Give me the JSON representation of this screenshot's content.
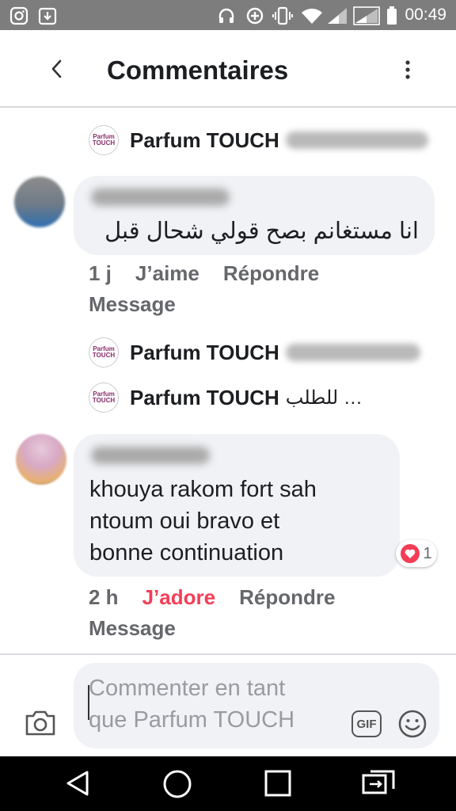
{
  "statusbar": {
    "time": "00:49"
  },
  "header": {
    "title": "Commentaires"
  },
  "reply_previews": [
    {
      "name": "Parfum TOUCH",
      "snippet": ""
    },
    {
      "name": "Parfum TOUCH",
      "snippet": ""
    },
    {
      "name": "Parfum TOUCH",
      "snippet": "… للطلب"
    }
  ],
  "page_avatar_text": "Parfum TOUCH",
  "comments": [
    {
      "text": "انا مستغانم  بصح قولي شحال قبل",
      "time": "1 j",
      "like_label": "J’aime",
      "reply_label": "Répondre",
      "message_label": "Message"
    },
    {
      "text_lines": [
        "khouya rakom fort sah",
        "ntoum oui bravo et",
        "bonne continuation"
      ],
      "time": "2 h",
      "like_label": "J’adore",
      "reply_label": "Répondre",
      "message_label": "Message",
      "reaction_count": "1"
    }
  ],
  "composer": {
    "placeholder_line1": "Commenter en tant",
    "placeholder_line2": "que Parfum TOUCH",
    "gif_label": "GIF"
  },
  "colors": {
    "love": "#f33e58",
    "meta": "#65676b",
    "bubble": "#f0f2f5",
    "statusbar": "#7d7d7d"
  }
}
